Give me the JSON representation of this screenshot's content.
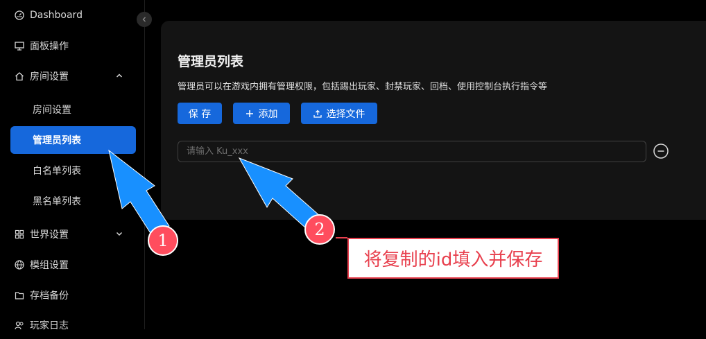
{
  "sidebar": {
    "items": [
      {
        "label": "Dashboard",
        "icon": "dashboard-icon"
      },
      {
        "label": "面板操作",
        "icon": "monitor-icon"
      },
      {
        "label": "房间设置",
        "icon": "home-icon",
        "expanded": true
      },
      {
        "label": "世界设置",
        "icon": "grid-icon",
        "expanded": false
      },
      {
        "label": "模组设置",
        "icon": "globe-icon"
      },
      {
        "label": "存档备份",
        "icon": "folder-icon"
      },
      {
        "label": "玩家日志",
        "icon": "users-icon"
      }
    ],
    "sub_items": [
      {
        "label": "房间设置"
      },
      {
        "label": "管理员列表",
        "active": true
      },
      {
        "label": "白名单列表"
      },
      {
        "label": "黑名单列表"
      }
    ]
  },
  "card": {
    "title": "管理员列表",
    "description": "管理员可以在游戏内拥有管理权限，包括踢出玩家、封禁玩家、回档、使用控制台执行指令等",
    "save_label": "保 存",
    "add_label": "添加",
    "choose_file_label": "选择文件",
    "input_placeholder": "请输入 Ku_xxx"
  },
  "annotations": {
    "badge_1": "1",
    "badge_2": "2",
    "note": "将复制的id填入并保存"
  },
  "colors": {
    "accent": "#1668dc",
    "arrow": "#1890ff",
    "badge": "#ff4d5e",
    "annotation_border": "#e8404e"
  }
}
